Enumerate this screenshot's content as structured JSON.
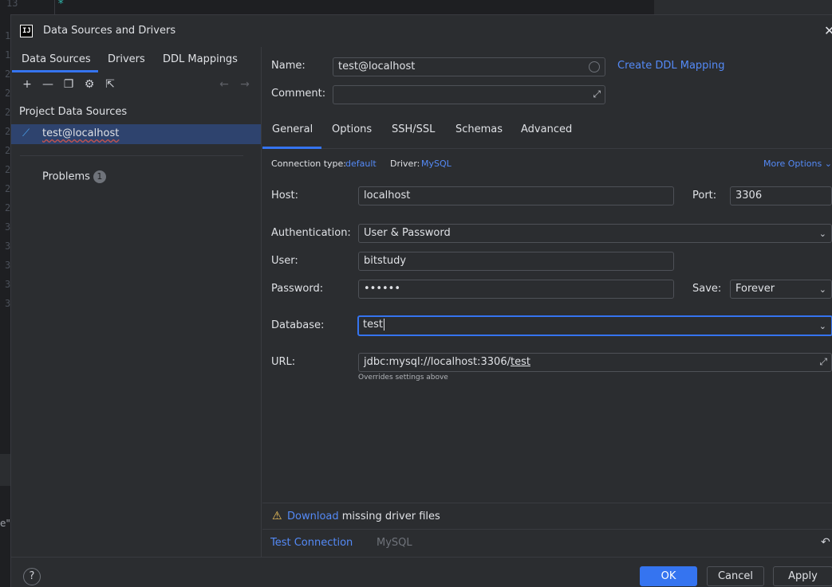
{
  "editor": {
    "top_line_number": "13",
    "top_line_code": "*",
    "left_fragment": "e\"",
    "gutter_numbers": [
      "1",
      "1",
      "2",
      "2",
      "2",
      "2",
      "2",
      "2",
      "2",
      "2",
      "3",
      "3",
      "3",
      "3",
      "3"
    ]
  },
  "dialog": {
    "title": "Data Sources and Drivers",
    "app_logo": "IJ"
  },
  "left": {
    "tabs": [
      "Data Sources",
      "Drivers",
      "DDL Mappings"
    ],
    "toolbar": {
      "add": "+",
      "remove": "—",
      "duplicate": "❐",
      "settings": "⚙",
      "export": "⇱",
      "back": "←",
      "forward": "→"
    },
    "section_title": "Project Data Sources",
    "data_source": "test@localhost",
    "problems_label": "Problems",
    "problems_count": "1"
  },
  "form": {
    "name_label": "Name:",
    "name_value": "test@localhost",
    "comment_label": "Comment:",
    "comment_value": "",
    "create_ddl_link": "Create DDL Mapping",
    "tabs": [
      "General",
      "Options",
      "SSH/SSL",
      "Schemas",
      "Advanced"
    ],
    "connection_type_label": "Connection type:",
    "connection_type_value": "default",
    "driver_label": "Driver:",
    "driver_value": "MySQL",
    "more_options": "More Options",
    "host_label": "Host:",
    "host_value": "localhost",
    "port_label": "Port:",
    "port_value": "3306",
    "auth_label": "Authentication:",
    "auth_value": "User & Password",
    "user_label": "User:",
    "user_value": "bitstudy",
    "password_label": "Password:",
    "password_value": "••••••",
    "save_label": "Save:",
    "save_value": "Forever",
    "database_label": "Database:",
    "database_value": "test",
    "url_label": "URL:",
    "url_prefix": "jdbc:mysql://localhost:3306/",
    "url_db": "test",
    "url_hint": "Overrides settings above"
  },
  "warning": {
    "download_link": "Download",
    "text": "missing driver files"
  },
  "test": {
    "test_connection": "Test Connection",
    "driver_name": "MySQL",
    "reset_icon": "↶"
  },
  "footer": {
    "help": "?",
    "ok": "OK",
    "cancel": "Cancel",
    "apply": "Apply"
  },
  "colors": {
    "accent": "#3574f0",
    "link": "#548af7",
    "selection": "#2e436e",
    "warning": "#f2c55c"
  }
}
